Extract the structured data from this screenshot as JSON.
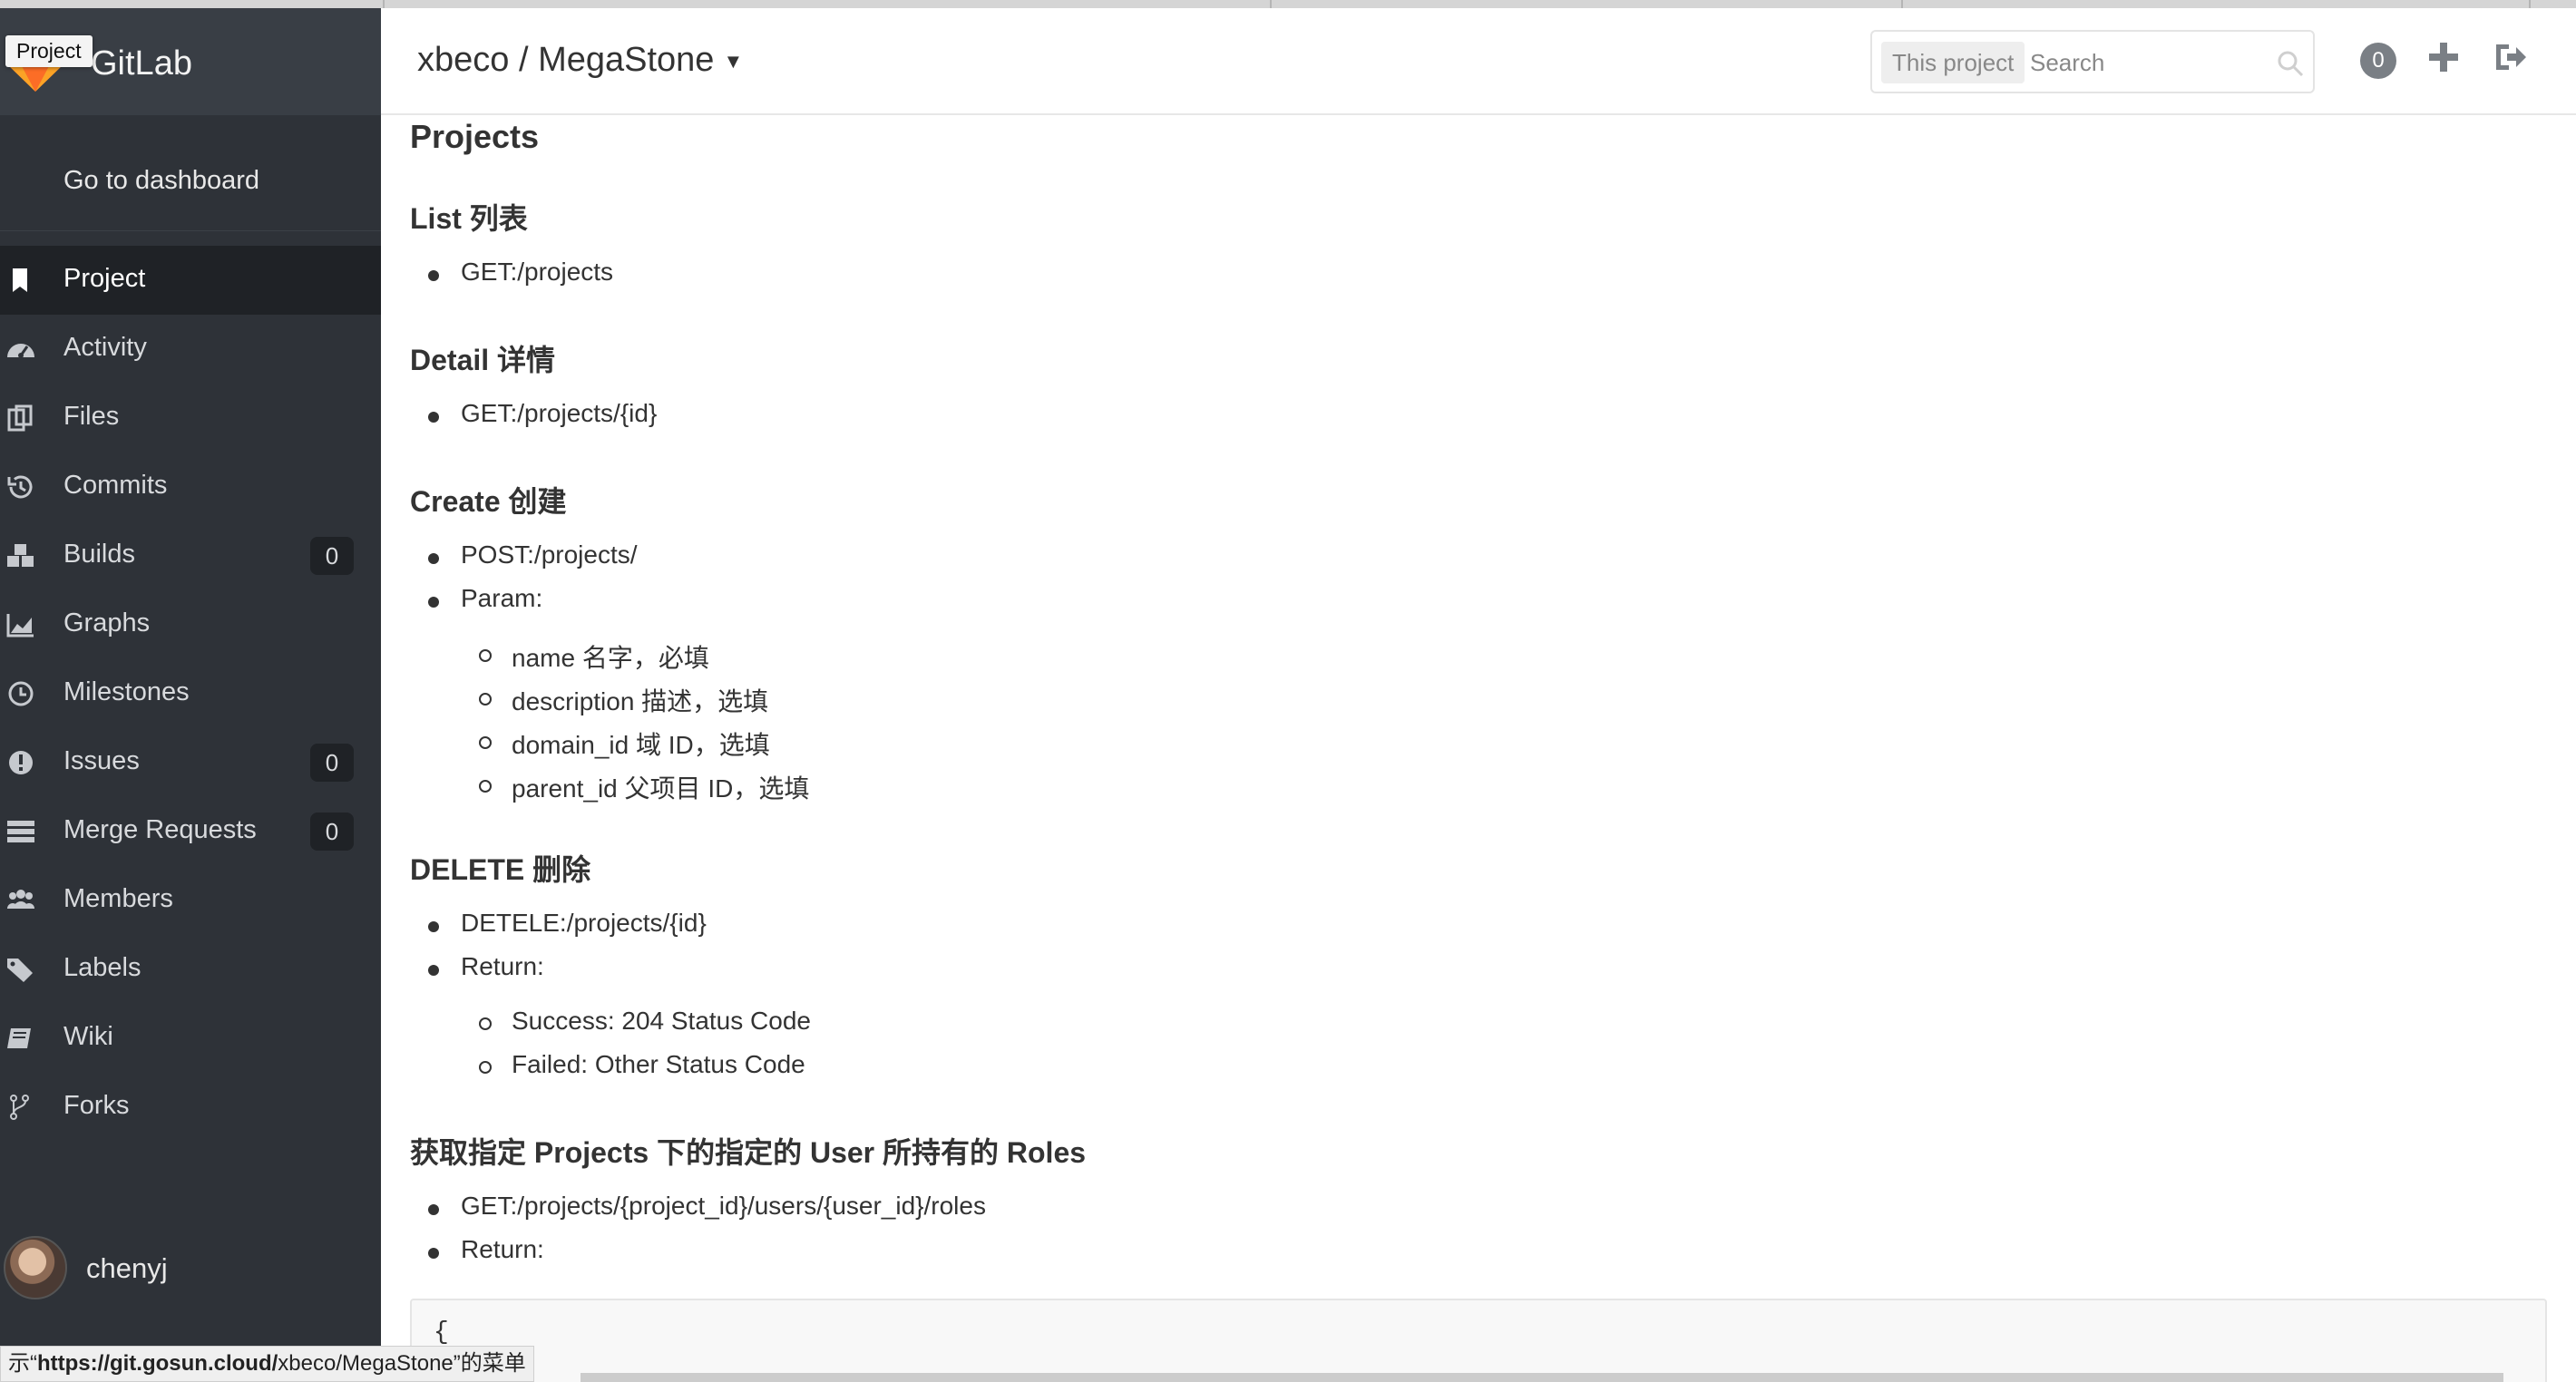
{
  "sidebar": {
    "tooltip": "Project",
    "brand": "GitLab",
    "dashboard_link": "Go to dashboard",
    "items": [
      {
        "label": "Project",
        "icon": "bookmark-icon",
        "count": null,
        "active": true
      },
      {
        "label": "Activity",
        "icon": "dashboard-gauge-icon",
        "count": null
      },
      {
        "label": "Files",
        "icon": "files-icon",
        "count": null
      },
      {
        "label": "Commits",
        "icon": "history-icon",
        "count": null
      },
      {
        "label": "Builds",
        "icon": "cubes-icon",
        "count": "0"
      },
      {
        "label": "Graphs",
        "icon": "area-chart-icon",
        "count": null
      },
      {
        "label": "Milestones",
        "icon": "clock-icon",
        "count": null
      },
      {
        "label": "Issues",
        "icon": "exclamation-circle-icon",
        "count": "0"
      },
      {
        "label": "Merge Requests",
        "icon": "tasks-icon",
        "count": "0"
      },
      {
        "label": "Members",
        "icon": "users-icon",
        "count": null
      },
      {
        "label": "Labels",
        "icon": "tags-icon",
        "count": null
      },
      {
        "label": "Wiki",
        "icon": "book-icon",
        "count": null
      },
      {
        "label": "Forks",
        "icon": "code-fork-icon",
        "count": null
      }
    ],
    "user": {
      "name": "chenyj"
    }
  },
  "header": {
    "breadcrumb": "xbeco / MegaStone",
    "search_scope": "This project",
    "search_placeholder": "Search",
    "notification_count": "0"
  },
  "content": {
    "title": "Projects",
    "sections": {
      "list": {
        "title": "List 列表",
        "bullets": [
          "GET:/projects"
        ]
      },
      "detail": {
        "title": "Detail 详情",
        "bullets": [
          "GET:/projects/{id}"
        ]
      },
      "create": {
        "title": "Create 创建",
        "bullets": [
          "POST:/projects/",
          "Param:"
        ],
        "params": [
          "name 名字，必填",
          "description 描述，选填",
          "domain_id 域 ID，选填",
          "parent_id 父项目 ID，选填"
        ]
      },
      "delete": {
        "title": "DELETE 删除",
        "bullets": [
          "DETELE:/projects/{id}",
          "Return:"
        ],
        "returns": [
          "Success: 204 Status Code",
          "Failed: Other Status Code"
        ]
      },
      "roles": {
        "title": "获取指定 Projects 下的指定的 User 所持有的 Roles",
        "bullets": [
          "GET:/projects/{project_id}/users/{user_id}/roles",
          "Return:"
        ]
      }
    },
    "code_first_line": "{"
  },
  "status_bar": {
    "prefix": "示“",
    "url_bold": "https://git.gosun.cloud/",
    "url_rest": "xbeco/MegaStone",
    "suffix": "”的菜单"
  },
  "colors": {
    "sidebar_bg": "#2e3238",
    "sidebar_header_bg": "#393e45",
    "active_item_bg": "#1f2226",
    "text": "#333333"
  }
}
